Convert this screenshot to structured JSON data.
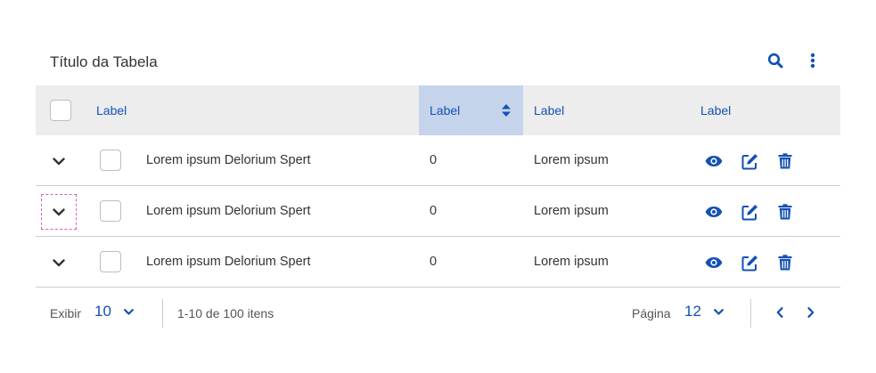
{
  "table": {
    "title": "Título da Tabela",
    "columns": [
      "Label",
      "Label",
      "Label",
      "Label"
    ],
    "sorted_column_index": 1,
    "rows": [
      {
        "col1": "Lorem ipsum Delorium Spert",
        "col2": "0",
        "col3": "Lorem ipsum"
      },
      {
        "col1": "Lorem ipsum Delorium Spert",
        "col2": "0",
        "col3": "Lorem ipsum"
      },
      {
        "col1": "Lorem ipsum Delorium Spert",
        "col2": "0",
        "col3": "Lorem ipsum"
      }
    ]
  },
  "toolbar": {
    "icons": [
      "search-icon",
      "more-vertical-icon"
    ]
  },
  "row_actions": {
    "icons": [
      "eye-icon",
      "edit-icon",
      "trash-icon"
    ]
  },
  "footer": {
    "show_label": "Exibir",
    "page_size": "10",
    "range_text": "1-10 de 100 itens",
    "page_label": "Página",
    "page_number": "12"
  },
  "colors": {
    "primary": "#1351b4",
    "header_bg": "#ededed",
    "sorted_header_bg": "#c5d4eb",
    "focus_outline": "#e05ab4"
  }
}
